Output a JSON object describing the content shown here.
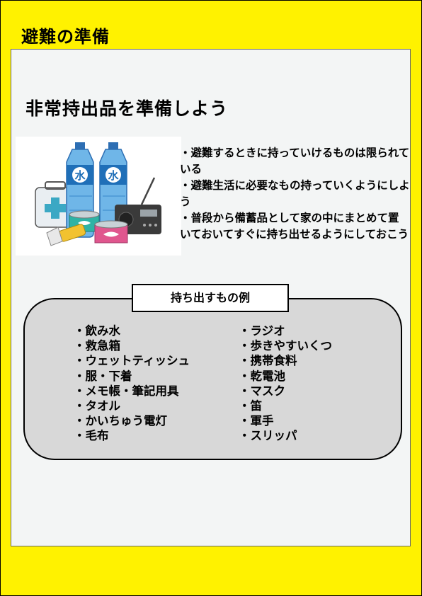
{
  "doc_title": "避難の準備",
  "heading": "非常持出品を準備しよう",
  "bullets": [
    "・避難するときに持っていけるものは限られている",
    "・避難生活に必要なもの持っていくようにしよう",
    "・普段から備蓄品として家の中にまとめて置いておいてすぐに持ち出せるようにしておこう"
  ],
  "illustration": {
    "bottle_label": "水",
    "icons": [
      "water-bottle-icon",
      "first-aid-kit-icon",
      "canned-food-icon",
      "radio-icon",
      "flashlight-icon"
    ],
    "colors": {
      "bottle": "#3B8ED6",
      "label": "#1F6FB8",
      "can_teal": "#2FB3A5",
      "can_pink": "#E0568E"
    }
  },
  "examples": {
    "label": "持ち出すもの例",
    "left": [
      "・飲み水",
      "・救急箱",
      "・ウェットティッシュ",
      "・服・下着",
      "・メモ帳・筆記用具",
      "・タオル",
      "・かいちゅう電灯",
      "・毛布"
    ],
    "right": [
      "・ラジオ",
      "・歩きやすいくつ",
      "・携帯食料",
      "・乾電池",
      "・マスク",
      "・笛",
      "・軍手",
      "・スリッパ"
    ]
  },
  "colors": {
    "page": "#FFF200",
    "panel": "#F3F5F5",
    "box": "#D8D8D8"
  }
}
